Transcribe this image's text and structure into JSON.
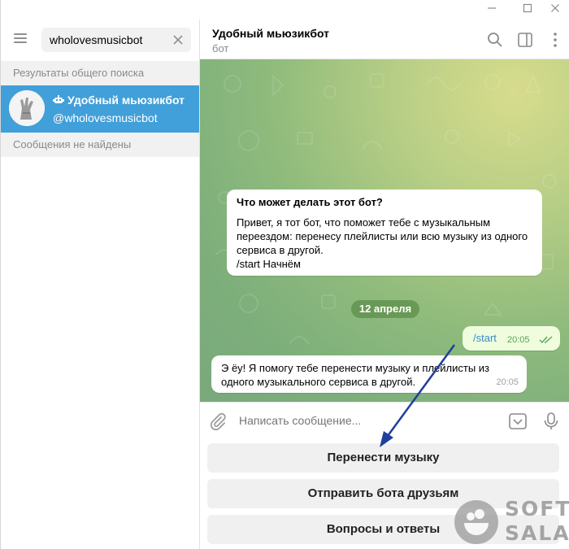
{
  "search": {
    "value": "wholovesmusicbot"
  },
  "left_panel": {
    "global_results_header": "Результаты общего поиска",
    "result": {
      "title": "Удобный мьюзикбот",
      "username": "@wholovesmusicbot"
    },
    "no_messages": "Сообщения не найдены"
  },
  "chat": {
    "title": "Удобный мьюзикбот",
    "status": "бот",
    "intro": {
      "heading": "Что может делать этот бот?",
      "body": "Привет, я тот бот, что поможет тебе с музыкальным переездом: перенесу плейлисты или всю музыку из одного сервиса в другой.",
      "command": "/start Начнём"
    },
    "date_divider": "12 апреля",
    "outgoing": {
      "text": "/start",
      "time": "20:05"
    },
    "reply": {
      "text": "Э ёу! Я помогу тебе перенести музыку и плейлисты из одного музыкального сервиса в другой.",
      "time": "20:05"
    }
  },
  "composer": {
    "placeholder": "Написать сообщение..."
  },
  "keyboard": {
    "buttons": [
      "Перенести музыку",
      "Отправить бота друзьям",
      "Вопросы и ответы"
    ]
  },
  "watermark": {
    "line1": "SOFT",
    "line2": "SALAD"
  },
  "colors": {
    "accent": "#419fd9",
    "arrow": "#1f3f9a",
    "outgoing_bubble": "#effdde"
  }
}
